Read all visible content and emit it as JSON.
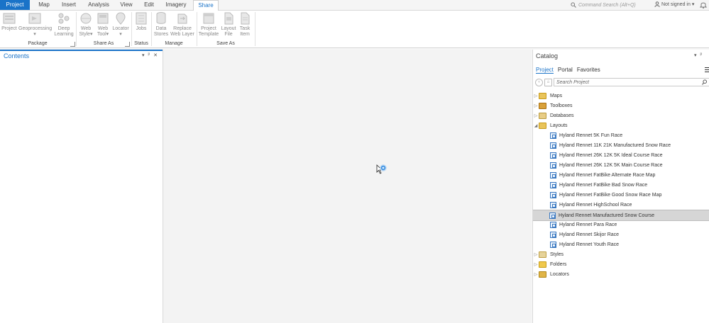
{
  "tabs": [
    "Project",
    "Map",
    "Insert",
    "Analysis",
    "View",
    "Edit",
    "Imagery",
    "Share"
  ],
  "command_search": {
    "placeholder": "Command Search (Alt+Q)"
  },
  "account": {
    "label": "Not signed in"
  },
  "ribbon": {
    "package": {
      "label": "Package",
      "buttons": [
        "Project",
        "Geoprocessing",
        "Deep Learning"
      ]
    },
    "share_as": {
      "label": "Share As",
      "buttons": [
        "Web Style",
        "Web Tool",
        "Locator"
      ]
    },
    "status": {
      "label": "Status",
      "buttons": [
        "Jobs"
      ]
    },
    "manage": {
      "label": "Manage",
      "buttons": [
        "Data Stores",
        "Replace Web Layer"
      ]
    },
    "save_as": {
      "label": "Save As",
      "buttons": [
        "Project Template",
        "Layout File",
        "Task Item"
      ]
    }
  },
  "contents": {
    "title": "Contents"
  },
  "catalog": {
    "title": "Catalog",
    "tabs": [
      "Project",
      "Portal",
      "Favorites"
    ],
    "search_placeholder": "Search Project",
    "tree": [
      {
        "label": "Maps",
        "kind": "folder",
        "expanded": false
      },
      {
        "label": "Toolboxes",
        "kind": "folder",
        "expanded": false
      },
      {
        "label": "Databases",
        "kind": "folder",
        "expanded": false
      },
      {
        "label": "Layouts",
        "kind": "folder",
        "expanded": true,
        "children": [
          "Hyland Rennet 5K Fun Race",
          "Hyland Rennet 11K 21K Manufactured Snow Race",
          "Hyland Rennet 26K 12K 5K Ideal Course Race",
          "Hyland Rennet 26K 12K 5K Main Course Race",
          "Hyland Rennet FatBike Alternate Race Map",
          "Hyland Rennet FatBike Bad Snow Race",
          "Hyland Rennet FatBike Good Snow Race Map",
          "Hyland Rennet HighSchool Race",
          "Hyland Rennet Manufactured Snow Course",
          "Hyland Rennet Para Race",
          "Hyland Rennet Skijor Race",
          "Hyland Rennet Youth Race"
        ],
        "selected_child": "Hyland Rennet Manufactured Snow Course"
      },
      {
        "label": "Styles",
        "kind": "folder",
        "expanded": false
      },
      {
        "label": "Folders",
        "kind": "folder",
        "expanded": false
      },
      {
        "label": "Locators",
        "kind": "folder",
        "expanded": false
      }
    ]
  },
  "colors": {
    "accent": "#1a73c8",
    "selected_row": "#d6d6d6"
  }
}
